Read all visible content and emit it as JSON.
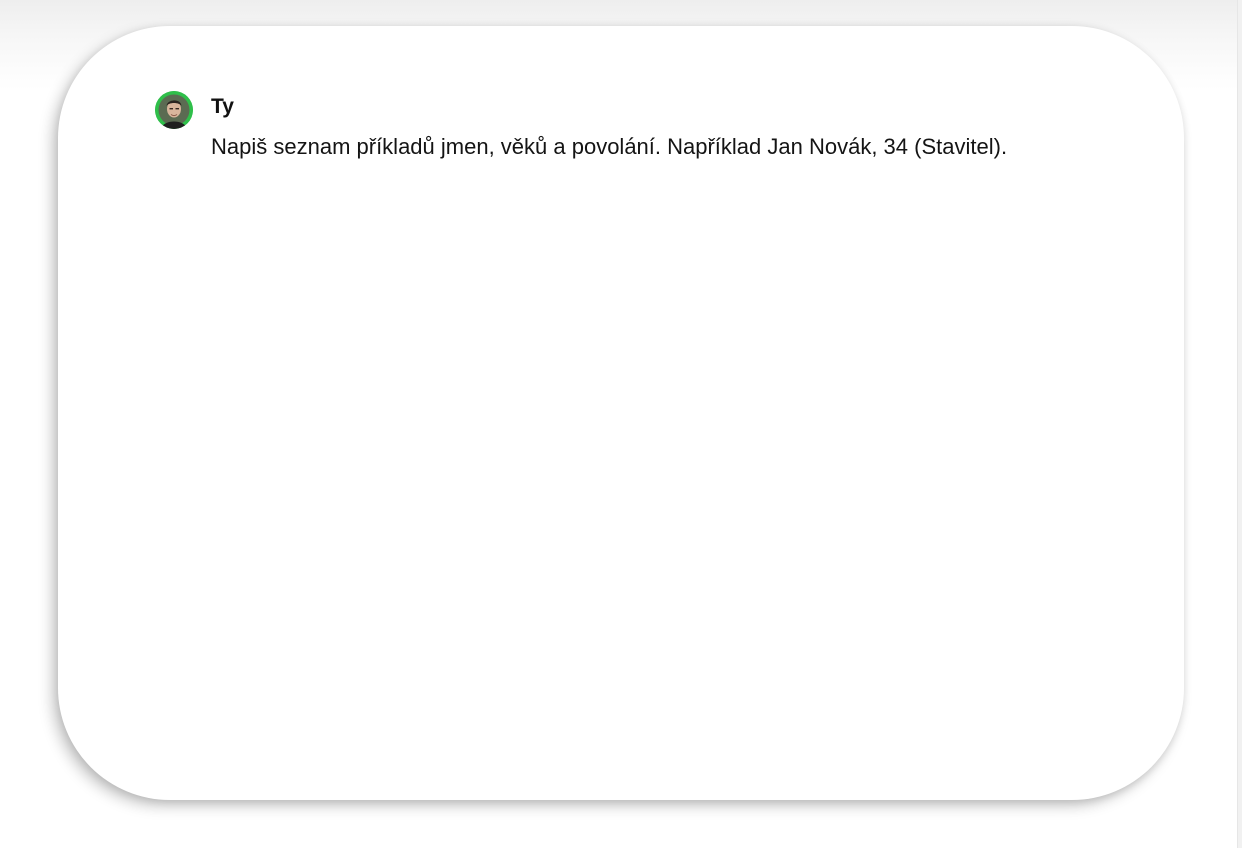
{
  "message": {
    "author": "Ty",
    "text": "Napiš seznam příkladů jmen, věků a povolání. Například Jan Novák, 34 (Stavitel).",
    "avatar_icon": "user-avatar-photo"
  },
  "colors": {
    "avatar_ring": "#2fbf4a",
    "text": "#141414",
    "card_background": "#ffffff"
  }
}
